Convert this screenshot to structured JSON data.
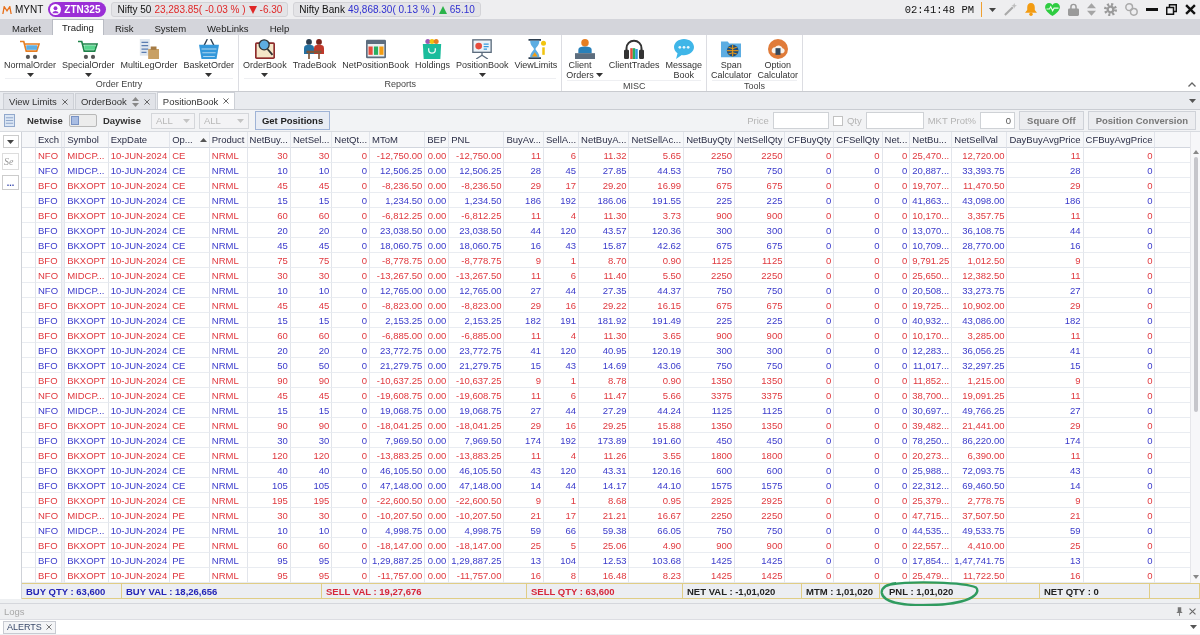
{
  "header": {
    "logo": "MYNT",
    "user_badge": "ZTN325",
    "tickers": [
      {
        "name": "Nifty 50",
        "value": "23,283.85( -0.03 % )",
        "rising": false,
        "change": "-6.30"
      },
      {
        "name": "Nifty Bank",
        "value": "49,868.30( 0.13 % )",
        "rising": true,
        "change": "65.10"
      }
    ],
    "clock": "02:41:48 PM"
  },
  "menu_tabs": [
    {
      "label": "Market",
      "selected": false
    },
    {
      "label": "Trading",
      "selected": true
    },
    {
      "label": "Risk",
      "selected": false
    },
    {
      "label": "System",
      "selected": false
    },
    {
      "label": "WebLinks",
      "selected": false
    },
    {
      "label": "Help",
      "selected": false
    }
  ],
  "ribbon": {
    "groups": [
      {
        "label": "Order Entry",
        "buttons": [
          {
            "label": "NormalOrder",
            "dropdown": true
          },
          {
            "label": "SpecialOrder",
            "dropdown": true
          },
          {
            "label": "MultiLegOrder",
            "dropdown": false
          },
          {
            "label": "BasketOrder",
            "dropdown": true
          }
        ]
      },
      {
        "label": "Reports",
        "buttons": [
          {
            "label": "OrderBook",
            "dropdown": true
          },
          {
            "label": "TradeBook",
            "dropdown": false
          },
          {
            "label": "NetPositionBook",
            "dropdown": false
          },
          {
            "label": "Holdings",
            "dropdown": false
          },
          {
            "label": "PositionBook",
            "dropdown": true
          },
          {
            "label": "ViewLimits",
            "dropdown": false
          }
        ]
      },
      {
        "label": "MISC",
        "buttons": [
          {
            "label": "Client Orders",
            "dropdown": true
          },
          {
            "label": "ClientTrades",
            "dropdown": false
          },
          {
            "label": "Message Book",
            "dropdown": false
          }
        ]
      },
      {
        "label": "Tools",
        "buttons": [
          {
            "label": "Span Calculator",
            "dropdown": false
          },
          {
            "label": "Option Calculator",
            "dropdown": false
          }
        ]
      }
    ]
  },
  "document_tabs": [
    {
      "label": "View Limits",
      "selected": false,
      "dockable": false
    },
    {
      "label": "OrderBook",
      "selected": false,
      "dockable": true
    },
    {
      "label": "PositionBook",
      "selected": true,
      "dockable": false
    }
  ],
  "toolbar": {
    "mode_switch": {
      "left_label": "Netwise",
      "right_label": "Daywise",
      "daywise": false
    },
    "filters": [
      {
        "value": "ALL",
        "disabled": true
      },
      {
        "value": "ALL",
        "disabled": true
      }
    ],
    "get_positions_button": "Get Positions",
    "price_field": {
      "label": "Price",
      "disabled": true
    },
    "qty_field": {
      "label": "Qty",
      "checked": false,
      "disabled": true
    },
    "market_protection_field": {
      "label": "MKT Prot%",
      "value": "0",
      "disabled": true
    },
    "buttons": [
      {
        "label": "Square Off",
        "disabled": true
      },
      {
        "label": "Position Conversion",
        "disabled": true
      }
    ]
  },
  "side_panel": {
    "search_placeholder": "Se",
    "more_button": "..."
  },
  "table": {
    "columns": [
      {
        "label": "Exch",
        "kind": "text",
        "sorted": false
      },
      {
        "label": "Symbol",
        "kind": "text",
        "sorted": false
      },
      {
        "label": "ExpDate",
        "kind": "text",
        "sorted": false
      },
      {
        "label": "Op...",
        "kind": "text",
        "sorted": true
      },
      {
        "label": "Product",
        "kind": "text",
        "sorted": false
      },
      {
        "label": "NetBuy...",
        "kind": "number",
        "sorted": false
      },
      {
        "label": "NetSel...",
        "kind": "number",
        "sorted": false
      },
      {
        "label": "NetQt...",
        "kind": "number",
        "sorted": false
      },
      {
        "label": "MToM",
        "kind": "number",
        "sorted": false
      },
      {
        "label": "BEP",
        "kind": "number",
        "sorted": false
      },
      {
        "label": "PNL",
        "kind": "number",
        "sorted": false
      },
      {
        "label": "BuyAv...",
        "kind": "number",
        "sorted": false
      },
      {
        "label": "SellA...",
        "kind": "number",
        "sorted": false
      },
      {
        "label": "NetBuyA...",
        "kind": "number",
        "sorted": false
      },
      {
        "label": "NetSellAc...",
        "kind": "number",
        "sorted": false
      },
      {
        "label": "NetBuyQty",
        "kind": "number",
        "sorted": false
      },
      {
        "label": "NetSellQty",
        "kind": "number",
        "sorted": false
      },
      {
        "label": "CFBuyQty",
        "kind": "number",
        "sorted": false
      },
      {
        "label": "CFSellQty",
        "kind": "number",
        "sorted": false
      },
      {
        "label": "Net...",
        "kind": "number",
        "sorted": false
      },
      {
        "label": "NetBu...",
        "kind": "number",
        "sorted": false
      },
      {
        "label": "NetSellVal",
        "kind": "number",
        "sorted": false
      },
      {
        "label": "DayBuyAvgPrice",
        "kind": "number",
        "sorted": false
      },
      {
        "label": "CFBuyAvgPrice",
        "kind": "number",
        "sorted": false
      }
    ],
    "rows": [
      {
        "kind": "loss",
        "cells": [
          "NFO",
          "MIDCP...",
          "10-JUN-2024",
          "CE",
          "NRML",
          "30",
          "30",
          "0",
          "-12,750.00",
          "0.00",
          "-12,750.00",
          "11",
          "6",
          "11.32",
          "5.65",
          "2250",
          "2250",
          "0",
          "0",
          "0",
          "25,470...",
          "12,720.00",
          "11",
          "0"
        ]
      },
      {
        "kind": "profit",
        "cells": [
          "NFO",
          "MIDCP...",
          "10-JUN-2024",
          "CE",
          "NRML",
          "10",
          "10",
          "0",
          "12,506.25",
          "0.00",
          "12,506.25",
          "28",
          "45",
          "27.85",
          "44.53",
          "750",
          "750",
          "0",
          "0",
          "0",
          "20,887...",
          "33,393.75",
          "28",
          "0"
        ]
      },
      {
        "kind": "loss",
        "cells": [
          "BFO",
          "BKXOPT",
          "10-JUN-2024",
          "CE",
          "NRML",
          "45",
          "45",
          "0",
          "-8,236.50",
          "0.00",
          "-8,236.50",
          "29",
          "17",
          "29.20",
          "16.99",
          "675",
          "675",
          "0",
          "0",
          "0",
          "19,707...",
          "11,470.50",
          "29",
          "0"
        ]
      },
      {
        "kind": "profit",
        "cells": [
          "BFO",
          "BKXOPT",
          "10-JUN-2024",
          "CE",
          "NRML",
          "15",
          "15",
          "0",
          "1,234.50",
          "0.00",
          "1,234.50",
          "186",
          "192",
          "186.06",
          "191.55",
          "225",
          "225",
          "0",
          "0",
          "0",
          "41,863...",
          "43,098.00",
          "186",
          "0"
        ]
      },
      {
        "kind": "loss",
        "cells": [
          "BFO",
          "BKXOPT",
          "10-JUN-2024",
          "CE",
          "NRML",
          "60",
          "60",
          "0",
          "-6,812.25",
          "0.00",
          "-6,812.25",
          "11",
          "4",
          "11.30",
          "3.73",
          "900",
          "900",
          "0",
          "0",
          "0",
          "10,170...",
          "3,357.75",
          "11",
          "0"
        ]
      },
      {
        "kind": "profit",
        "cells": [
          "BFO",
          "BKXOPT",
          "10-JUN-2024",
          "CE",
          "NRML",
          "20",
          "20",
          "0",
          "23,038.50",
          "0.00",
          "23,038.50",
          "44",
          "120",
          "43.57",
          "120.36",
          "300",
          "300",
          "0",
          "0",
          "0",
          "13,070...",
          "36,108.75",
          "44",
          "0"
        ]
      },
      {
        "kind": "profit",
        "cells": [
          "BFO",
          "BKXOPT",
          "10-JUN-2024",
          "CE",
          "NRML",
          "45",
          "45",
          "0",
          "18,060.75",
          "0.00",
          "18,060.75",
          "16",
          "43",
          "15.87",
          "42.62",
          "675",
          "675",
          "0",
          "0",
          "0",
          "10,709...",
          "28,770.00",
          "16",
          "0"
        ]
      },
      {
        "kind": "loss",
        "cells": [
          "BFO",
          "BKXOPT",
          "10-JUN-2024",
          "CE",
          "NRML",
          "75",
          "75",
          "0",
          "-8,778.75",
          "0.00",
          "-8,778.75",
          "9",
          "1",
          "8.70",
          "0.90",
          "1125",
          "1125",
          "0",
          "0",
          "0",
          "9,791.25",
          "1,012.50",
          "9",
          "0"
        ]
      },
      {
        "kind": "loss",
        "cells": [
          "NFO",
          "MIDCP...",
          "10-JUN-2024",
          "CE",
          "NRML",
          "30",
          "30",
          "0",
          "-13,267.50",
          "0.00",
          "-13,267.50",
          "11",
          "6",
          "11.40",
          "5.50",
          "2250",
          "2250",
          "0",
          "0",
          "0",
          "25,650...",
          "12,382.50",
          "11",
          "0"
        ]
      },
      {
        "kind": "profit",
        "cells": [
          "NFO",
          "MIDCP...",
          "10-JUN-2024",
          "CE",
          "NRML",
          "10",
          "10",
          "0",
          "12,765.00",
          "0.00",
          "12,765.00",
          "27",
          "44",
          "27.35",
          "44.37",
          "750",
          "750",
          "0",
          "0",
          "0",
          "20,508...",
          "33,273.75",
          "27",
          "0"
        ]
      },
      {
        "kind": "loss",
        "cells": [
          "BFO",
          "BKXOPT",
          "10-JUN-2024",
          "CE",
          "NRML",
          "45",
          "45",
          "0",
          "-8,823.00",
          "0.00",
          "-8,823.00",
          "29",
          "16",
          "29.22",
          "16.15",
          "675",
          "675",
          "0",
          "0",
          "0",
          "19,725...",
          "10,902.00",
          "29",
          "0"
        ]
      },
      {
        "kind": "profit",
        "cells": [
          "BFO",
          "BKXOPT",
          "10-JUN-2024",
          "CE",
          "NRML",
          "15",
          "15",
          "0",
          "2,153.25",
          "0.00",
          "2,153.25",
          "182",
          "191",
          "181.92",
          "191.49",
          "225",
          "225",
          "0",
          "0",
          "0",
          "40,932...",
          "43,086.00",
          "182",
          "0"
        ]
      },
      {
        "kind": "loss",
        "cells": [
          "BFO",
          "BKXOPT",
          "10-JUN-2024",
          "CE",
          "NRML",
          "60",
          "60",
          "0",
          "-6,885.00",
          "0.00",
          "-6,885.00",
          "11",
          "4",
          "11.30",
          "3.65",
          "900",
          "900",
          "0",
          "0",
          "0",
          "10,170...",
          "3,285.00",
          "11",
          "0"
        ]
      },
      {
        "kind": "profit",
        "cells": [
          "BFO",
          "BKXOPT",
          "10-JUN-2024",
          "CE",
          "NRML",
          "20",
          "20",
          "0",
          "23,772.75",
          "0.00",
          "23,772.75",
          "41",
          "120",
          "40.95",
          "120.19",
          "300",
          "300",
          "0",
          "0",
          "0",
          "12,283...",
          "36,056.25",
          "41",
          "0"
        ]
      },
      {
        "kind": "profit",
        "cells": [
          "BFO",
          "BKXOPT",
          "10-JUN-2024",
          "CE",
          "NRML",
          "50",
          "50",
          "0",
          "21,279.75",
          "0.00",
          "21,279.75",
          "15",
          "43",
          "14.69",
          "43.06",
          "750",
          "750",
          "0",
          "0",
          "0",
          "11,017...",
          "32,297.25",
          "15",
          "0"
        ]
      },
      {
        "kind": "loss",
        "cells": [
          "BFO",
          "BKXOPT",
          "10-JUN-2024",
          "CE",
          "NRML",
          "90",
          "90",
          "0",
          "-10,637.25",
          "0.00",
          "-10,637.25",
          "9",
          "1",
          "8.78",
          "0.90",
          "1350",
          "1350",
          "0",
          "0",
          "0",
          "11,852...",
          "1,215.00",
          "9",
          "0"
        ]
      },
      {
        "kind": "loss",
        "cells": [
          "NFO",
          "MIDCP...",
          "10-JUN-2024",
          "CE",
          "NRML",
          "45",
          "45",
          "0",
          "-19,608.75",
          "0.00",
          "-19,608.75",
          "11",
          "6",
          "11.47",
          "5.66",
          "3375",
          "3375",
          "0",
          "0",
          "0",
          "38,700...",
          "19,091.25",
          "11",
          "0"
        ]
      },
      {
        "kind": "profit",
        "cells": [
          "NFO",
          "MIDCP...",
          "10-JUN-2024",
          "CE",
          "NRML",
          "15",
          "15",
          "0",
          "19,068.75",
          "0.00",
          "19,068.75",
          "27",
          "44",
          "27.29",
          "44.24",
          "1125",
          "1125",
          "0",
          "0",
          "0",
          "30,697...",
          "49,766.25",
          "27",
          "0"
        ]
      },
      {
        "kind": "loss",
        "cells": [
          "BFO",
          "BKXOPT",
          "10-JUN-2024",
          "CE",
          "NRML",
          "90",
          "90",
          "0",
          "-18,041.25",
          "0.00",
          "-18,041.25",
          "29",
          "16",
          "29.25",
          "15.88",
          "1350",
          "1350",
          "0",
          "0",
          "0",
          "39,482...",
          "21,441.00",
          "29",
          "0"
        ]
      },
      {
        "kind": "profit",
        "cells": [
          "BFO",
          "BKXOPT",
          "10-JUN-2024",
          "CE",
          "NRML",
          "30",
          "30",
          "0",
          "7,969.50",
          "0.00",
          "7,969.50",
          "174",
          "192",
          "173.89",
          "191.60",
          "450",
          "450",
          "0",
          "0",
          "0",
          "78,250...",
          "86,220.00",
          "174",
          "0"
        ]
      },
      {
        "kind": "loss",
        "cells": [
          "BFO",
          "BKXOPT",
          "10-JUN-2024",
          "CE",
          "NRML",
          "120",
          "120",
          "0",
          "-13,883.25",
          "0.00",
          "-13,883.25",
          "11",
          "4",
          "11.26",
          "3.55",
          "1800",
          "1800",
          "0",
          "0",
          "0",
          "20,273...",
          "6,390.00",
          "11",
          "0"
        ]
      },
      {
        "kind": "profit",
        "cells": [
          "BFO",
          "BKXOPT",
          "10-JUN-2024",
          "CE",
          "NRML",
          "40",
          "40",
          "0",
          "46,105.50",
          "0.00",
          "46,105.50",
          "43",
          "120",
          "43.31",
          "120.16",
          "600",
          "600",
          "0",
          "0",
          "0",
          "25,988...",
          "72,093.75",
          "43",
          "0"
        ]
      },
      {
        "kind": "profit",
        "cells": [
          "BFO",
          "BKXOPT",
          "10-JUN-2024",
          "CE",
          "NRML",
          "105",
          "105",
          "0",
          "47,148.00",
          "0.00",
          "47,148.00",
          "14",
          "44",
          "14.17",
          "44.10",
          "1575",
          "1575",
          "0",
          "0",
          "0",
          "22,312...",
          "69,460.50",
          "14",
          "0"
        ]
      },
      {
        "kind": "loss",
        "cells": [
          "BFO",
          "BKXOPT",
          "10-JUN-2024",
          "CE",
          "NRML",
          "195",
          "195",
          "0",
          "-22,600.50",
          "0.00",
          "-22,600.50",
          "9",
          "1",
          "8.68",
          "0.95",
          "2925",
          "2925",
          "0",
          "0",
          "0",
          "25,379...",
          "2,778.75",
          "9",
          "0"
        ]
      },
      {
        "kind": "loss",
        "cells": [
          "NFO",
          "MIDCP...",
          "10-JUN-2024",
          "PE",
          "NRML",
          "30",
          "30",
          "0",
          "-10,207.50",
          "0.00",
          "-10,207.50",
          "21",
          "17",
          "21.21",
          "16.67",
          "2250",
          "2250",
          "0",
          "0",
          "0",
          "47,715...",
          "37,507.50",
          "21",
          "0"
        ]
      },
      {
        "kind": "profit",
        "cells": [
          "NFO",
          "MIDCP...",
          "10-JUN-2024",
          "PE",
          "NRML",
          "10",
          "10",
          "0",
          "4,998.75",
          "0.00",
          "4,998.75",
          "59",
          "66",
          "59.38",
          "66.05",
          "750",
          "750",
          "0",
          "0",
          "0",
          "44,535...",
          "49,533.75",
          "59",
          "0"
        ]
      },
      {
        "kind": "loss",
        "cells": [
          "BFO",
          "BKXOPT",
          "10-JUN-2024",
          "PE",
          "NRML",
          "60",
          "60",
          "0",
          "-18,147.00",
          "0.00",
          "-18,147.00",
          "25",
          "5",
          "25.06",
          "4.90",
          "900",
          "900",
          "0",
          "0",
          "0",
          "22,557...",
          "4,410.00",
          "25",
          "0"
        ]
      },
      {
        "kind": "profit",
        "cells": [
          "BFO",
          "BKXOPT",
          "10-JUN-2024",
          "PE",
          "NRML",
          "95",
          "95",
          "0",
          "1,29,887.25",
          "0.00",
          "1,29,887.25",
          "13",
          "104",
          "12.53",
          "103.68",
          "1425",
          "1425",
          "0",
          "0",
          "0",
          "17,854...",
          "1,47,741.75",
          "13",
          "0"
        ]
      },
      {
        "kind": "loss",
        "cells": [
          "BFO",
          "BKXOPT",
          "10-JUN-2024",
          "PE",
          "NRML",
          "95",
          "95",
          "0",
          "-11,757.00",
          "0.00",
          "-11,757.00",
          "16",
          "8",
          "16.48",
          "8.23",
          "1425",
          "1425",
          "0",
          "0",
          "0",
          "25,479...",
          "11,722.50",
          "16",
          "0"
        ]
      }
    ]
  },
  "totals_bar": [
    {
      "label": "BUY QTY : 63,600",
      "kind": "buy",
      "circled": false
    },
    {
      "label": "BUY VAL : 18,26,656",
      "kind": "buy",
      "circled": false
    },
    {
      "label": "SELL VAL : 19,27,676",
      "kind": "sell",
      "circled": false
    },
    {
      "label": "SELL QTY : 63,600",
      "kind": "sell",
      "circled": false
    },
    {
      "label": "NET VAL : -1,01,020",
      "kind": "net",
      "circled": false
    },
    {
      "label": "MTM : 1,01,020",
      "kind": "net",
      "circled": false
    },
    {
      "label": "PNL : 1,01,020",
      "kind": "net",
      "circled": true
    },
    {
      "label": "NET QTY : 0",
      "kind": "net",
      "circled": false
    }
  ],
  "logs_panel": {
    "title": "Logs",
    "tabs": [
      {
        "label": "ALERTS",
        "selected": true
      }
    ]
  }
}
